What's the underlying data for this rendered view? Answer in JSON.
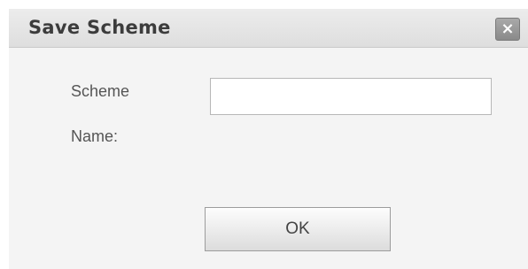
{
  "dialog": {
    "title": "Save Scheme",
    "close_icon": "close-icon",
    "field_label_line1": "Scheme",
    "field_label_line2": "Name:",
    "scheme_name_value": "",
    "ok_label": "OK"
  },
  "colors": {
    "dialog_background": "#f4f4f4",
    "titlebar_background": "#e4e4e4",
    "close_button_background": "#999999"
  }
}
